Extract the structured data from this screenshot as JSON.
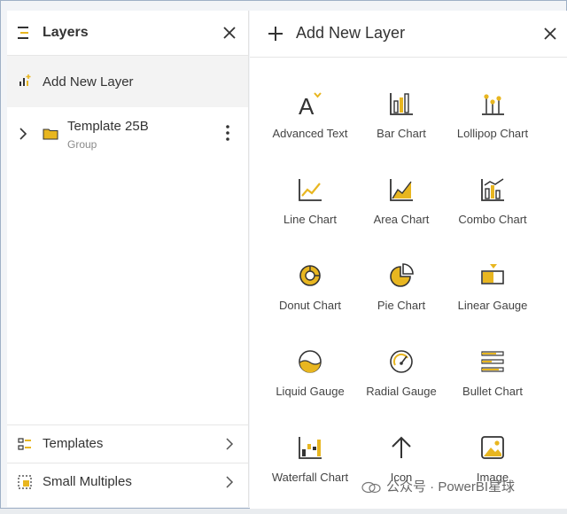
{
  "colors": {
    "accent": "#e8b620",
    "icon": "#333333",
    "muted": "#8a8a8a"
  },
  "layers_panel": {
    "title": "Layers",
    "add_new_layer": "Add New Layer",
    "tree_item": {
      "name": "Template 25B",
      "type": "Group"
    },
    "templates_label": "Templates",
    "small_multiples_label": "Small Multiples"
  },
  "add_panel": {
    "title": "Add New Layer",
    "tiles": [
      {
        "label": "Advanced Text",
        "icon": "advanced-text-icon"
      },
      {
        "label": "Bar Chart",
        "icon": "bar-chart-icon"
      },
      {
        "label": "Lollipop Chart",
        "icon": "lollipop-chart-icon"
      },
      {
        "label": "Line Chart",
        "icon": "line-chart-icon"
      },
      {
        "label": "Area Chart",
        "icon": "area-chart-icon"
      },
      {
        "label": "Combo Chart",
        "icon": "combo-chart-icon"
      },
      {
        "label": "Donut Chart",
        "icon": "donut-chart-icon"
      },
      {
        "label": "Pie Chart",
        "icon": "pie-chart-icon"
      },
      {
        "label": "Linear Gauge",
        "icon": "linear-gauge-icon"
      },
      {
        "label": "Liquid Gauge",
        "icon": "liquid-gauge-icon"
      },
      {
        "label": "Radial Gauge",
        "icon": "radial-gauge-icon"
      },
      {
        "label": "Bullet Chart",
        "icon": "bullet-chart-icon"
      },
      {
        "label": "Waterfall Chart",
        "icon": "waterfall-chart-icon"
      },
      {
        "label": "Icon",
        "icon": "arrow-up-icon"
      },
      {
        "label": "Image",
        "icon": "image-icon"
      }
    ]
  },
  "watermark": "公众号 · PowerBI星球"
}
